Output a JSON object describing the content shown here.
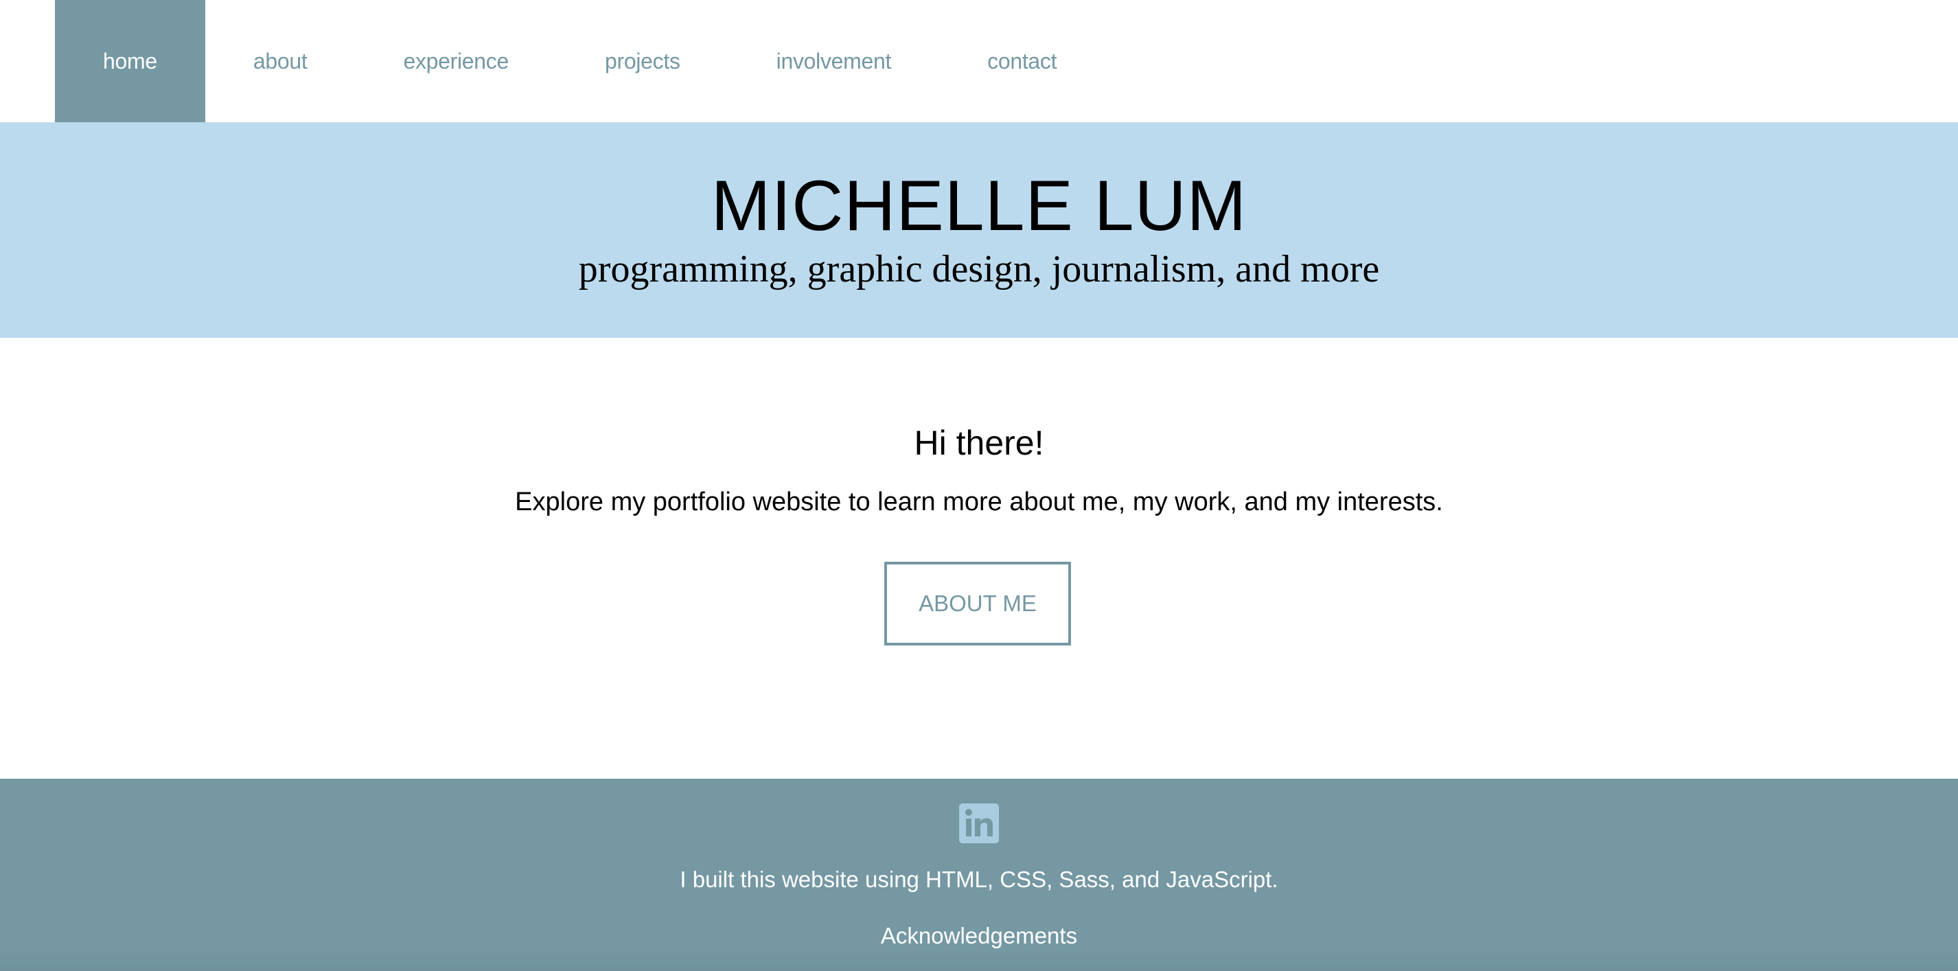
{
  "nav": {
    "items": [
      {
        "label": "home",
        "active": true
      },
      {
        "label": "about",
        "active": false
      },
      {
        "label": "experience",
        "active": false
      },
      {
        "label": "projects",
        "active": false
      },
      {
        "label": "involvement",
        "active": false
      },
      {
        "label": "contact",
        "active": false
      }
    ]
  },
  "hero": {
    "title": "MICHELLE LUM",
    "subtitle": "programming, graphic design, journalism, and more"
  },
  "main": {
    "greeting": "Hi there!",
    "intro": "Explore my portfolio website to learn more about me, my work, and my interests.",
    "button_label": "ABOUT ME"
  },
  "footer": {
    "social_icon": "linkedin-icon",
    "built_text": "I built this website using HTML, CSS, Sass, and JavaScript.",
    "acknowledgements_label": "Acknowledgements"
  },
  "colors": {
    "accent": "#7598a3",
    "banner": "#bcdaee",
    "icon": "#a9cce0"
  }
}
